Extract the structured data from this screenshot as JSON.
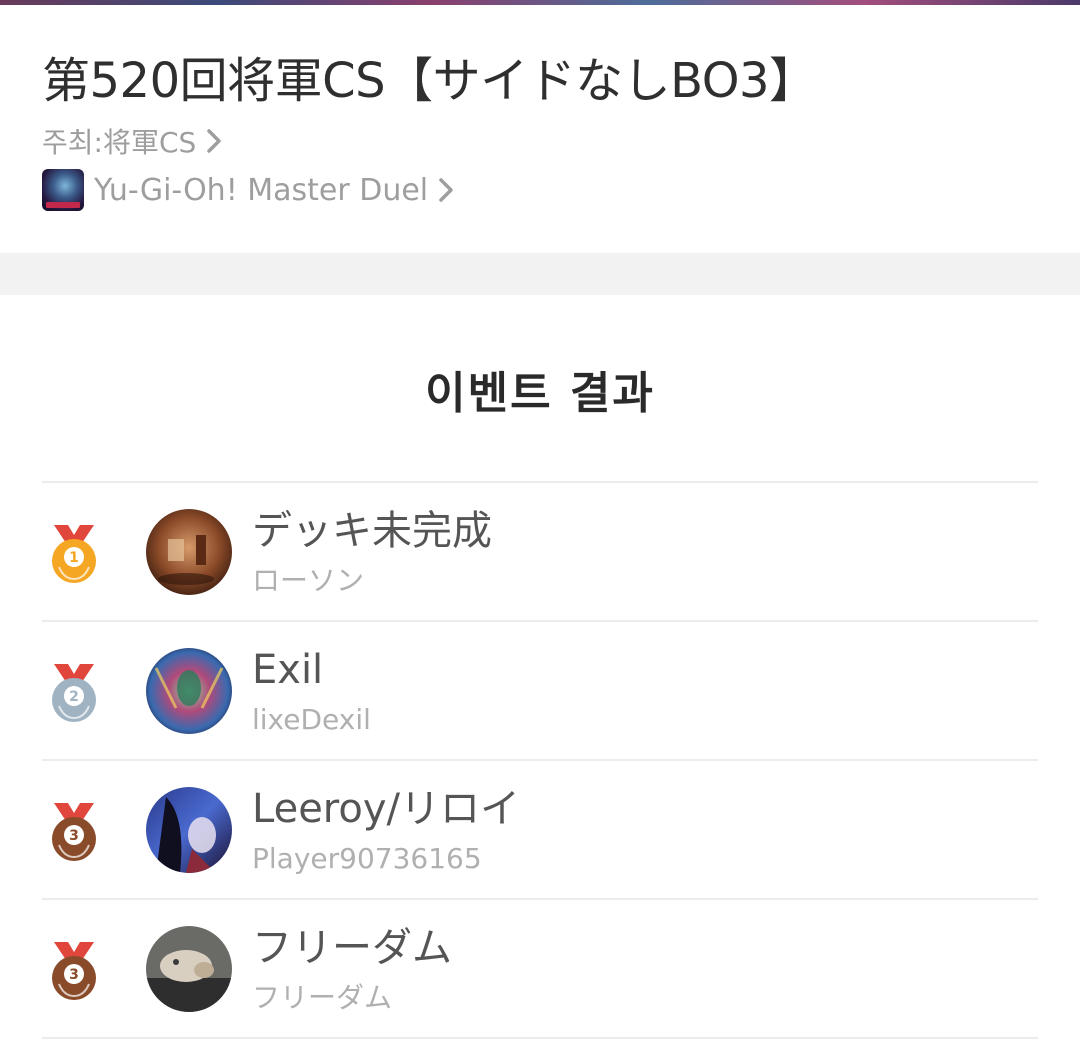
{
  "event": {
    "title": "第520回将軍CS【サイドなしBO3】",
    "host_label": "주최:将軍CS",
    "game_name": "Yu-Gi-Oh! Master Duel",
    "game_icon": "master-duel-app-icon"
  },
  "results": {
    "heading": "이벤트 결과",
    "rows": [
      {
        "rank": "1",
        "medal_color": "#f5a623",
        "name": "デッキ未完成",
        "sub": "ローソン"
      },
      {
        "rank": "2",
        "medal_color": "#9fb3c2",
        "name": "Exil",
        "sub": "lixeDexil"
      },
      {
        "rank": "3",
        "medal_color": "#8a4b2a",
        "name": "Leeroy/リロイ",
        "sub": "Player90736165"
      },
      {
        "rank": "3",
        "medal_color": "#8a4b2a",
        "name": "フリーダム",
        "sub": "フリーダム"
      }
    ]
  },
  "colors": {
    "ribbon": "#e0463c",
    "divider": "#ececec",
    "band": "#f2f2f2"
  }
}
